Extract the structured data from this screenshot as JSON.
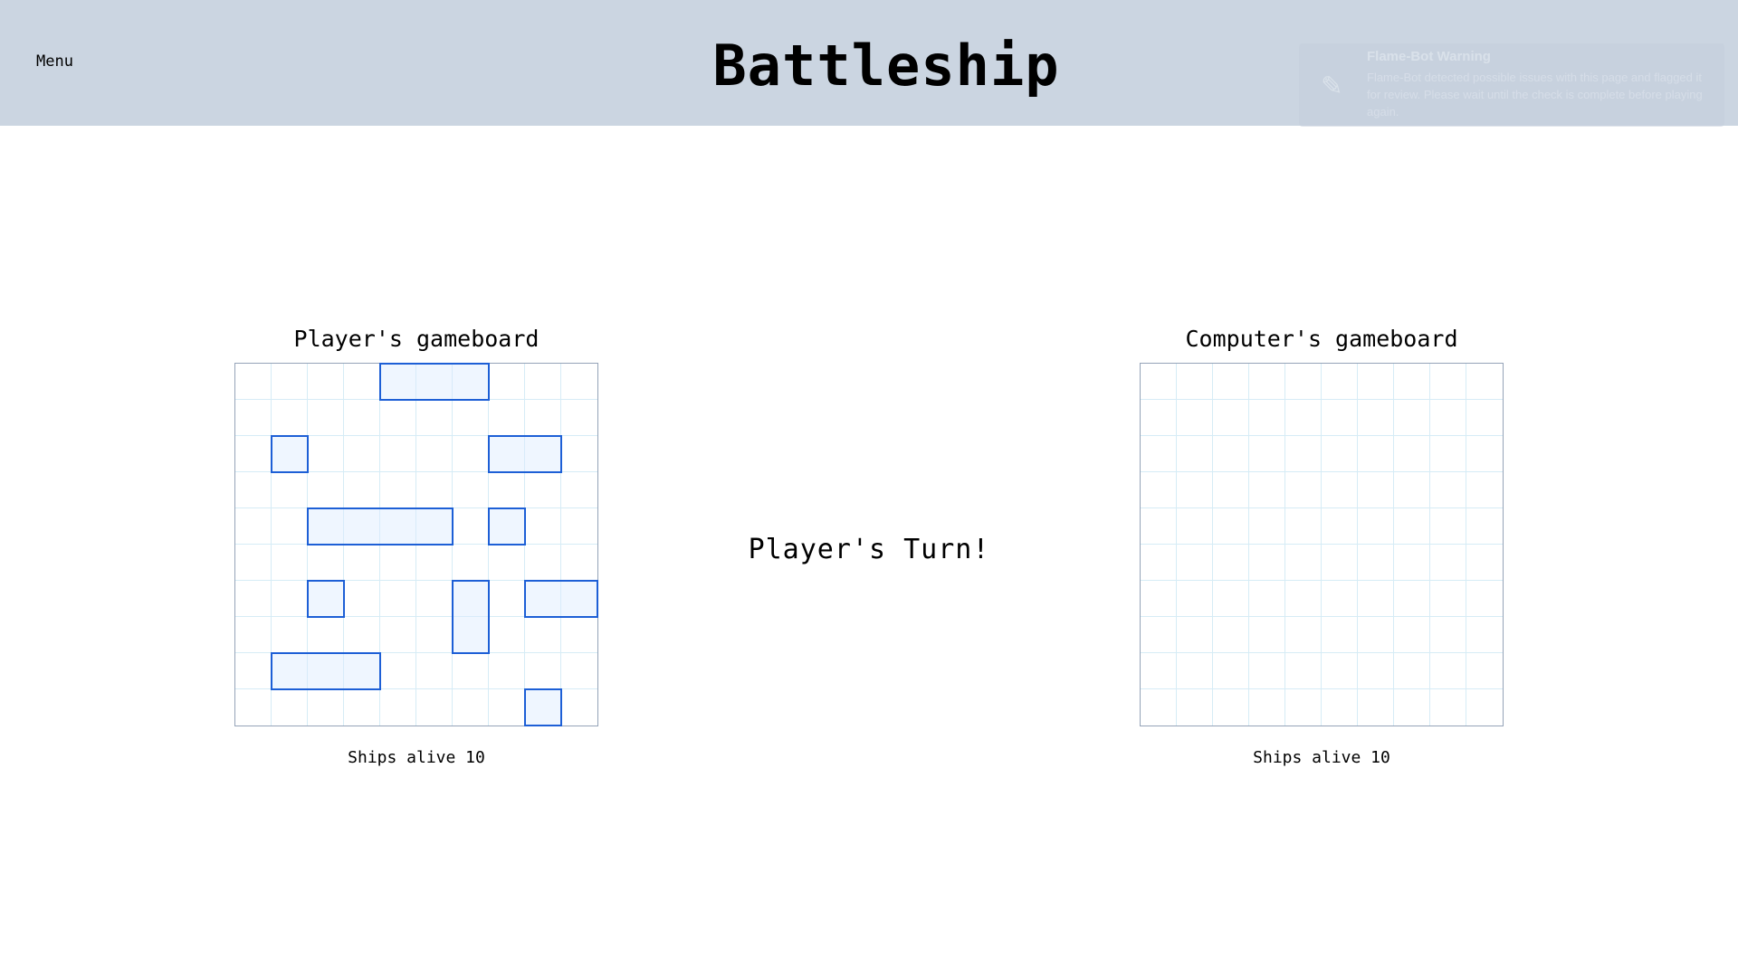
{
  "header": {
    "menu_label": "Menu",
    "title": "Battleship"
  },
  "toast": {
    "icon": "bug-icon",
    "title": "Flame-Bot Warning",
    "text": "Flame-Bot detected possible issues with this page and flagged it for review. Please wait until the check is complete before playing again."
  },
  "status": {
    "turn_text": "Player's Turn!"
  },
  "player_board": {
    "title": "Player's gameboard",
    "ships_alive_text": "Ships alive 10",
    "grid_size": 10,
    "ships": [
      {
        "row": 0,
        "col": 4,
        "length": 3,
        "orientation": "horizontal"
      },
      {
        "row": 2,
        "col": 1,
        "length": 1,
        "orientation": "horizontal"
      },
      {
        "row": 2,
        "col": 7,
        "length": 2,
        "orientation": "horizontal"
      },
      {
        "row": 4,
        "col": 2,
        "length": 4,
        "orientation": "horizontal"
      },
      {
        "row": 4,
        "col": 7,
        "length": 1,
        "orientation": "horizontal"
      },
      {
        "row": 6,
        "col": 2,
        "length": 1,
        "orientation": "horizontal"
      },
      {
        "row": 6,
        "col": 6,
        "length": 2,
        "orientation": "vertical"
      },
      {
        "row": 6,
        "col": 8,
        "length": 2,
        "orientation": "horizontal"
      },
      {
        "row": 8,
        "col": 1,
        "length": 3,
        "orientation": "horizontal"
      },
      {
        "row": 9,
        "col": 8,
        "length": 1,
        "orientation": "horizontal"
      }
    ]
  },
  "computer_board": {
    "title": "Computer's gameboard",
    "ships_alive_text": "Ships alive 10",
    "grid_size": 10
  },
  "colors": {
    "header_bg": "#cbd5e1",
    "ship_border": "#1d5fd6",
    "grid_line": "#d6ecf6",
    "board_border": "#94a3b8"
  }
}
